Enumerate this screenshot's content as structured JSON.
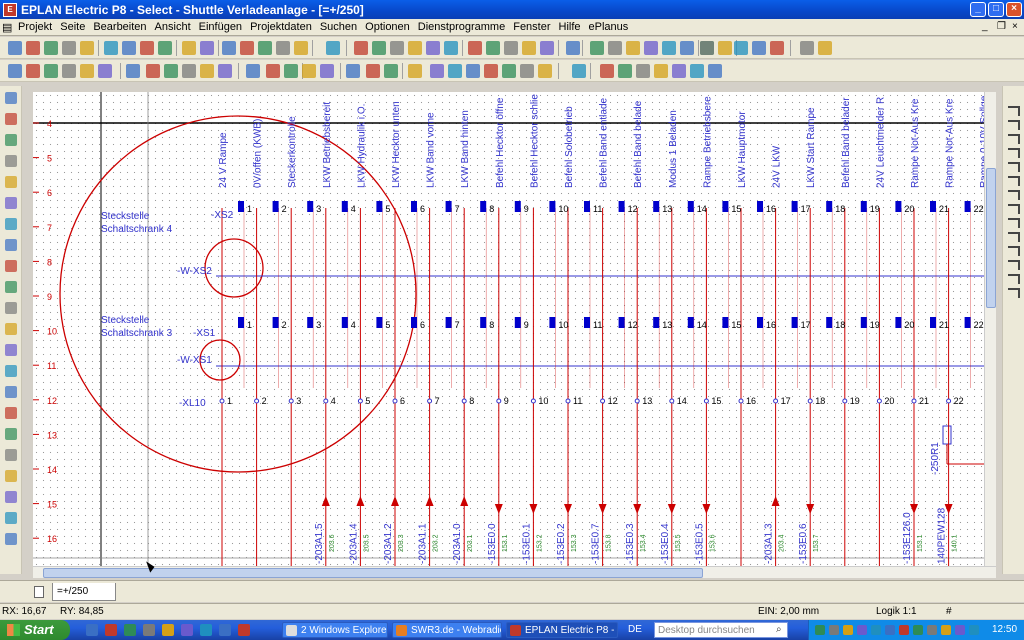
{
  "window": {
    "title": "EPLAN Electric P8 - Select - Shuttle Verladeanlage - [=+/250]",
    "icon": "eplan-app-icon"
  },
  "menu": [
    "Projekt",
    "Seite",
    "Bearbeiten",
    "Ansicht",
    "Einfügen",
    "Projektdaten",
    "Suchen",
    "Optionen",
    "Dienstprogramme",
    "Fenster",
    "Hilfe",
    "ePlanus"
  ],
  "drawing": {
    "rows": [
      "4",
      "5",
      "6",
      "7",
      "8",
      "9",
      "10",
      "11",
      "12",
      "13",
      "14",
      "15",
      "16"
    ],
    "column_labels": [
      "24 V Rampe",
      "0V/offen (KWB)",
      "Steckerkontrolle",
      "LKW Betriebsbereit",
      "LKW Hydraulik i.O.",
      "LKW Hecktor unten",
      "LKW Band vorne",
      "LKW Band hinten",
      "Befehl Hecktor öffne",
      "Befehl Hecktor schlie",
      "Befehl Solobetrieb",
      "Befehl Band entlade",
      "Befehl Band belade",
      "Modus 1 Beladen",
      "Rampe Betriebsbere",
      "LKW Hauptmotor",
      "24V LKW",
      "LKW Start Rampe",
      "Befehl Band belader",
      "24V Leuchtmelder R",
      "Rampe Not-Aus Kre",
      "Rampe Not-Aus Kre",
      "Rampe 0-10V Sollge"
    ],
    "strip_xs2": {
      "label": "-XS2",
      "terminals": [
        "1",
        "2",
        "3",
        "4",
        "5",
        "6",
        "7",
        "8",
        "9",
        "10",
        "11",
        "12",
        "13",
        "14",
        "15",
        "16",
        "17",
        "18",
        "19",
        "20",
        "21",
        "22"
      ]
    },
    "strip_xs1": {
      "label": "-XS1",
      "terminals": [
        "1",
        "2",
        "3",
        "4",
        "5",
        "6",
        "7",
        "8",
        "9",
        "10",
        "11",
        "12",
        "13",
        "14",
        "15",
        "16",
        "17",
        "18",
        "19",
        "20",
        "21",
        "22"
      ]
    },
    "strip_xl10": {
      "label": "-XL10",
      "terminals": [
        "1",
        "2",
        "3",
        "4",
        "5",
        "6",
        "7",
        "8",
        "9",
        "10",
        "11",
        "12",
        "13",
        "14",
        "15",
        "16",
        "17",
        "18",
        "19",
        "20",
        "21",
        "22"
      ]
    },
    "cable_wxs2": "-W-XS2",
    "cable_wxs1": "-W-XS1",
    "plug4_line1": "Steckstelle",
    "plug4_line2": "Schaltschrank 4",
    "plug3_line1": "Steckstelle",
    "plug3_line2": "Schaltschrank 3",
    "resistor": "-250R1",
    "references": [
      {
        "col": 4,
        "text": "-203A1.5",
        "sub": "203.6",
        "dir": "up"
      },
      {
        "col": 5,
        "text": "-203A1.4",
        "sub": "203.5",
        "dir": "up"
      },
      {
        "col": 6,
        "text": "-203A1.2",
        "sub": "203.3",
        "dir": "up"
      },
      {
        "col": 7,
        "text": "-203A1.1",
        "sub": "203.2",
        "dir": "up"
      },
      {
        "col": 8,
        "text": "-203A1.0",
        "sub": "203.1",
        "dir": "up"
      },
      {
        "col": 9,
        "text": "-153E0.0",
        "sub": "153.1",
        "dir": "down"
      },
      {
        "col": 10,
        "text": "-153E0.1",
        "sub": "153.2",
        "dir": "down"
      },
      {
        "col": 11,
        "text": "-153E0.2",
        "sub": "153.3",
        "dir": "down"
      },
      {
        "col": 12,
        "text": "-153E0.7",
        "sub": "153.8",
        "dir": "down"
      },
      {
        "col": 13,
        "text": "-153E0.3",
        "sub": "153.4",
        "dir": "down"
      },
      {
        "col": 14,
        "text": "-153E0.4",
        "sub": "153.5",
        "dir": "down"
      },
      {
        "col": 15,
        "text": "-153E0.5",
        "sub": "153.6",
        "dir": "down"
      },
      {
        "col": 17,
        "text": "-203A1.3",
        "sub": "203.4",
        "dir": "up"
      },
      {
        "col": 18,
        "text": "-153E0.6",
        "sub": "153.7",
        "dir": "down"
      },
      {
        "col": 21,
        "text": "-153E126.0",
        "sub": "153.1",
        "dir": "down"
      },
      {
        "col": 22,
        "text": "140PEW128",
        "sub": "140.1",
        "dir": "down"
      }
    ]
  },
  "tabs": {
    "page": "=+/250"
  },
  "status": {
    "rx": "RX: 16,67",
    "ry": "RY: 84,85",
    "ein": "EIN: 2,00 mm",
    "logik": "Logik 1:1",
    "hash": "#"
  },
  "taskbar": {
    "start": "Start",
    "tasks": [
      "2 Windows Explorer",
      "SWR3.de - Webradio...",
      "EPLAN Electric P8 - S..."
    ],
    "lang": "DE",
    "search_placeholder": "Desktop durchsuchen",
    "clock": "12:50"
  },
  "colors": {
    "title": "#0a5ee8",
    "drawing_blue": "#3333cc",
    "drawing_red": "#cc0000",
    "terminal": "#0000cc"
  }
}
